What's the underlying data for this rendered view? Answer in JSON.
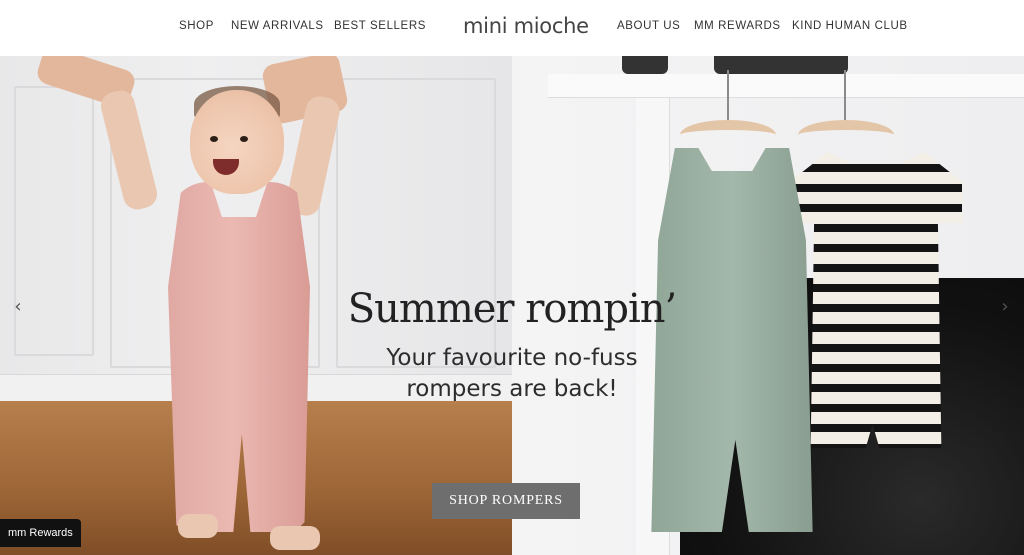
{
  "header": {
    "left_nav": [
      {
        "label": "SHOP"
      },
      {
        "label": "NEW ARRIVALS"
      },
      {
        "label": "BEST SELLERS"
      }
    ],
    "logo": "mini mioche",
    "right_nav": [
      {
        "label": "ABOUT US"
      },
      {
        "label": "MM REWARDS"
      },
      {
        "label": "KIND HUMAN CLUB"
      }
    ]
  },
  "hero": {
    "headline": "Summer rompin’",
    "subline_1": "Your favourite no-fuss",
    "subline_2": "rompers are back!",
    "cta_label": "SHOP ROMPERS",
    "prev_arrow": "‹",
    "next_arrow": "›",
    "prev_icon": "chevron-left-icon",
    "next_icon": "chevron-right-icon"
  },
  "rewards_badge": "mm Rewards",
  "colors": {
    "cta_background": "#6e6e6e",
    "rewards_background": "#111111",
    "text_dark": "#222222"
  }
}
